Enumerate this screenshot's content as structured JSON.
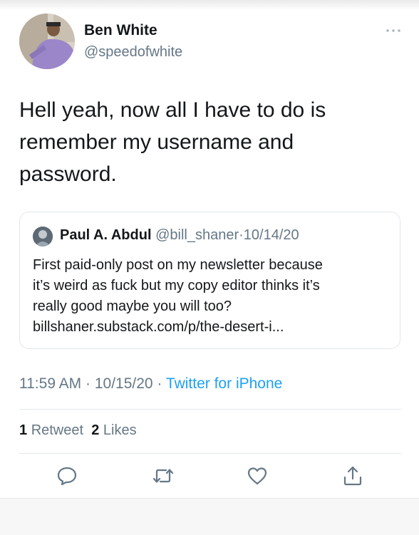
{
  "tweet": {
    "author_name": "Ben White",
    "author_handle": "@speedofwhite",
    "text": "Hell yeah, now all I have to do is\nremember my username and\npassword.",
    "quoted": {
      "author_name": "Paul A. Abdul",
      "author_handle": "@bill_shaner",
      "date": "10/14/20",
      "separator": "·",
      "text": "First paid-only post on my newsletter because\nit’s weird as fuck but my copy editor thinks it’s\nreally good maybe you will too?\nbillshaner.substack.com/p/the-desert-i..."
    },
    "time": "11:59 AM",
    "date": "10/15/20",
    "source": "Twitter for iPhone",
    "retweet_count": "1",
    "retweet_label": "Retweet",
    "like_count": "2",
    "like_label": "Likes"
  },
  "icons": {
    "more": "more-horizontal-icon",
    "reply": "reply-icon",
    "retweet": "retweet-icon",
    "like": "heart-icon",
    "share": "share-icon"
  },
  "colors": {
    "text": "#14171a",
    "secondary": "#657786",
    "link": "#1da1f2",
    "border": "#e1e8ed"
  }
}
